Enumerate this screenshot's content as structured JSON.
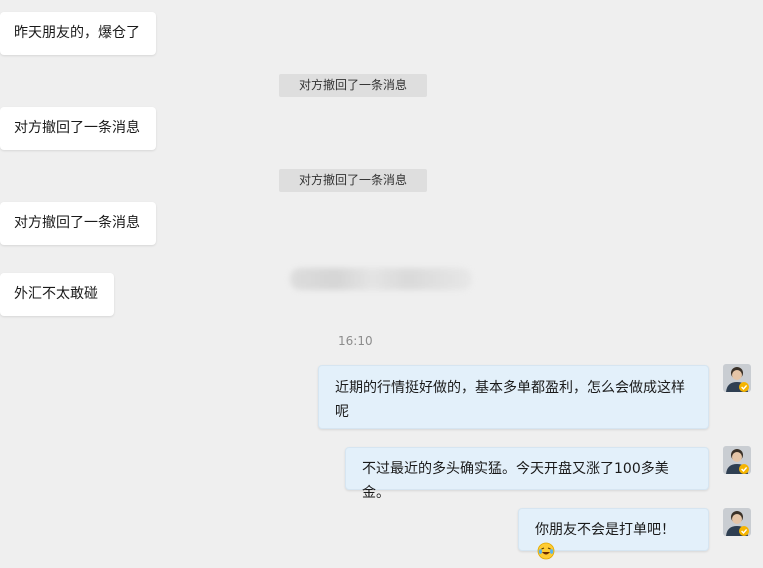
{
  "messages": {
    "in_1": "昨天朋友的，爆仓了",
    "sys_1": "对方撤回了一条消息",
    "in_2": "对方撤回了一条消息",
    "sys_2": "对方撤回了一条消息",
    "in_3": "对方撤回了一条消息",
    "in_4": "外汇不太敢碰",
    "timestamp": "16:10",
    "out_1": "近期的行情挺好做的，基本多单都盈利，怎么会做成这样呢",
    "out_2": "不过最近的多头确实猛。今天开盘又涨了100多美金。",
    "out_3": "你朋友不会是打单吧！"
  },
  "icons": {
    "avatar": "user-avatar-icon",
    "verified": "verified-badge-icon",
    "emoji": "laughing-tears-emoji-icon"
  },
  "colors": {
    "background": "#efefef",
    "incoming_bubble": "#ffffff",
    "outgoing_bubble": "#e3f0fa",
    "system_notice": "#dedede",
    "verified_badge": "#f5b400"
  }
}
